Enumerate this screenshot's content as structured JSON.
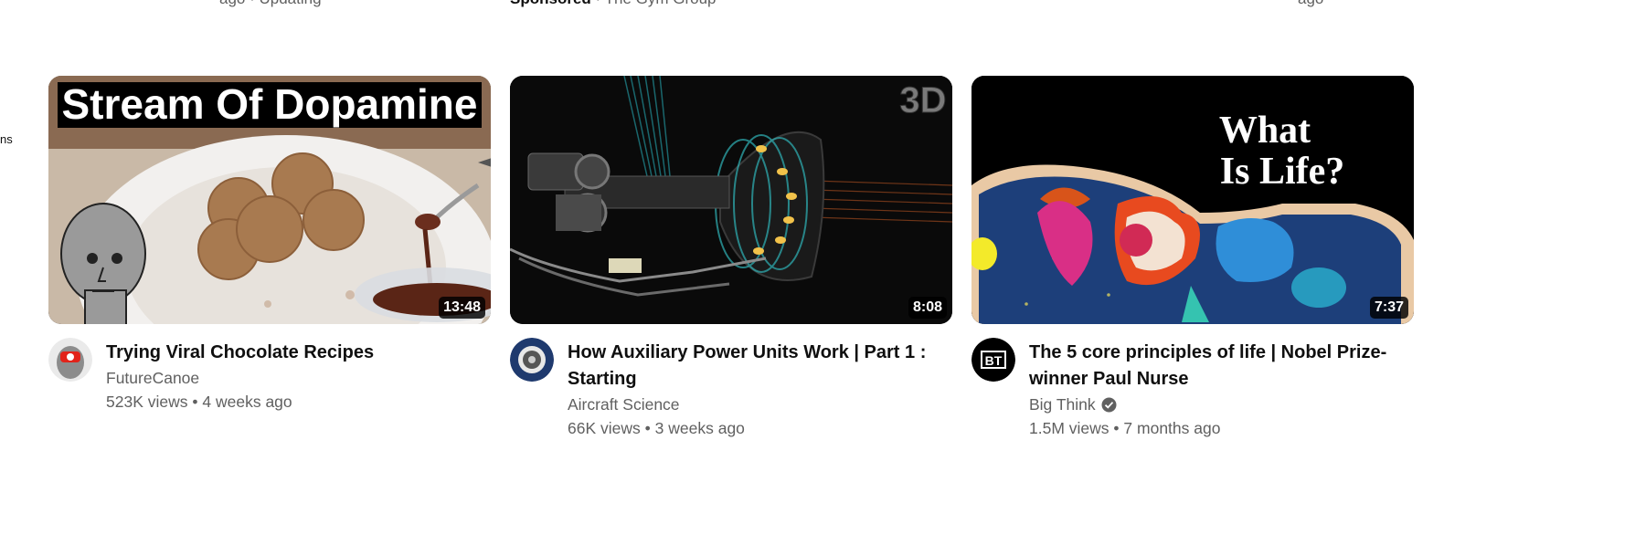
{
  "clipped": {
    "top_left": "ago · Updating",
    "top_center_sponsored": "Sponsored",
    "top_center_sep": "·",
    "top_center_advertiser": "The Gym Group",
    "left_edge": "ns",
    "top_right": "ago"
  },
  "videos": [
    {
      "thumbnail_text": "Stream Of Dopamine",
      "duration": "13:48",
      "title": "Trying Viral Chocolate Recipes",
      "channel": "FutureCanoe",
      "views": "523K views",
      "sep": "•",
      "age": "4 weeks ago",
      "verified": false
    },
    {
      "thumbnail_text": "3D",
      "duration": "8:08",
      "title": "How Auxiliary Power Units Work | Part 1 : Starting",
      "channel": "Aircraft Science",
      "views": "66K views",
      "sep": "•",
      "age": "3 weeks ago",
      "verified": false
    },
    {
      "thumbnail_text_line1": "What",
      "thumbnail_text_line2": "Is Life?",
      "duration": "7:37",
      "title": "The 5 core principles of life | Nobel Prize-winner Paul Nurse",
      "channel": "Big Think",
      "views": "1.5M views",
      "sep": "•",
      "age": "7 months ago",
      "verified": true,
      "avatar_text": "BT"
    }
  ],
  "colors": {
    "title": "#0f0f0f",
    "secondary": "#606060",
    "duration_bg": "#000000cc"
  }
}
